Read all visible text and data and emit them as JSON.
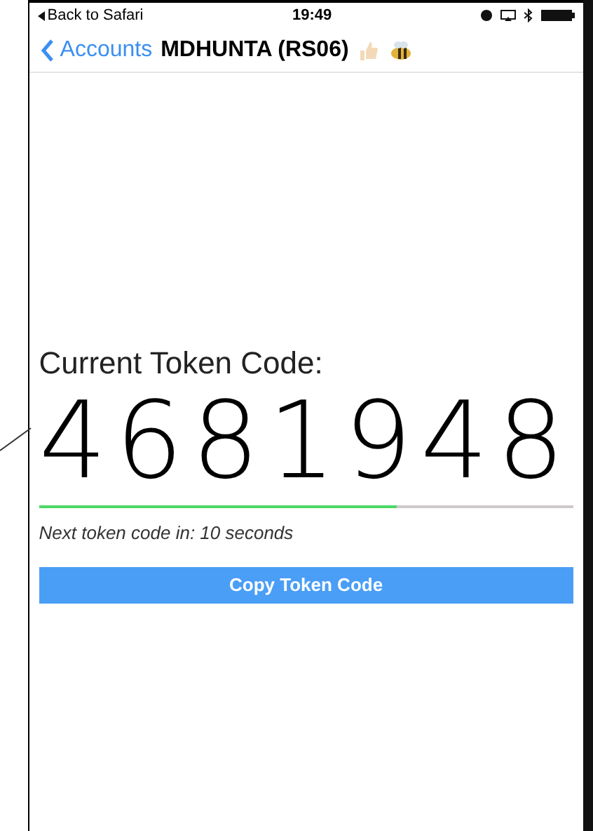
{
  "status_bar": {
    "back_label": "Back to Safari",
    "time": "19:49"
  },
  "nav": {
    "back": "Accounts",
    "title": "MDHUNTA (RS06)"
  },
  "token": {
    "heading": "Current Token Code:",
    "code": "4681948",
    "level": 0.67,
    "countdown": "Next token code in: 10 seconds"
  },
  "button": "Copy Token Code"
}
